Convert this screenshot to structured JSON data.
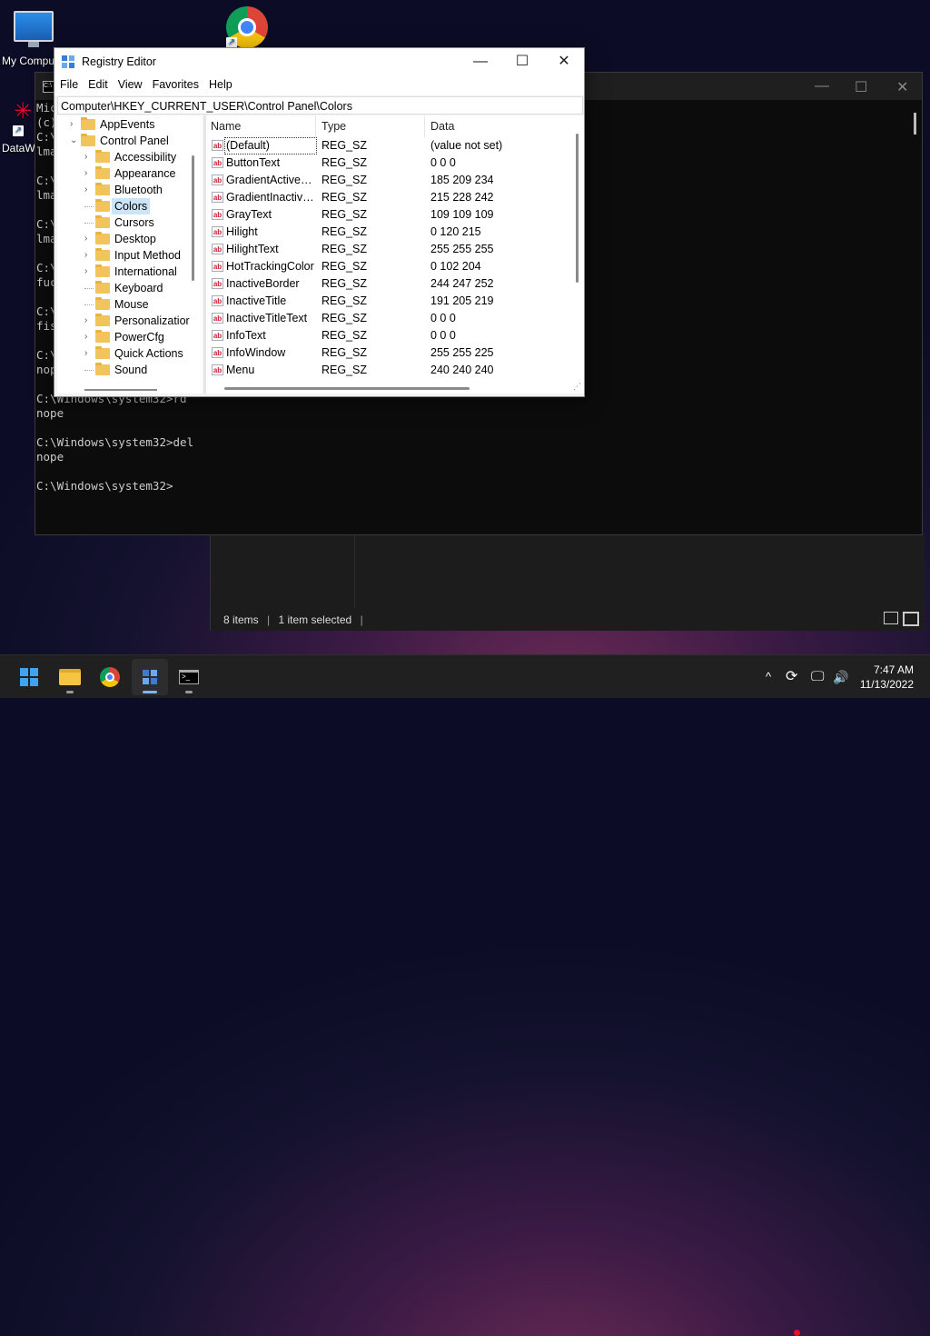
{
  "desktop": {
    "icons": [
      {
        "label": "My Compu"
      },
      {
        "label": "DataW"
      }
    ]
  },
  "cmd": {
    "lines": [
      "Mic",
      "(c)",
      "C:\\",
      "lma",
      "",
      "C:\\",
      "lma",
      "",
      "C:\\",
      "lma",
      "",
      "C:\\",
      "fuc",
      "",
      "C:\\",
      "fis",
      "",
      "C:\\",
      "nop",
      "",
      "C:\\Windows\\system32>rd",
      "nope",
      "",
      "C:\\Windows\\system32>del",
      "nope",
      "",
      "C:\\Windows\\system32>"
    ],
    "controls": {
      "minimize": "—",
      "maximize": "☐",
      "close": "✕"
    }
  },
  "explorer": {
    "status": {
      "items": "8 items",
      "selected": "1 item selected"
    }
  },
  "regedit": {
    "title": "Registry Editor",
    "controls": {
      "minimize": "—",
      "maximize": "☐",
      "close": "✕"
    },
    "menu": [
      "File",
      "Edit",
      "View",
      "Favorites",
      "Help"
    ],
    "address": "Computer\\HKEY_CURRENT_USER\\Control Panel\\Colors",
    "tree": [
      {
        "label": "AppEvents",
        "level": 0,
        "expander": "›"
      },
      {
        "label": "Control Panel",
        "level": 0,
        "expander": "⌄"
      },
      {
        "label": "Accessibility",
        "level": 1,
        "expander": "›"
      },
      {
        "label": "Appearance",
        "level": 1,
        "expander": "›"
      },
      {
        "label": "Bluetooth",
        "level": 1,
        "expander": "›"
      },
      {
        "label": "Colors",
        "level": 1,
        "expander": "",
        "selected": true
      },
      {
        "label": "Cursors",
        "level": 1,
        "expander": ""
      },
      {
        "label": "Desktop",
        "level": 1,
        "expander": "›"
      },
      {
        "label": "Input Method",
        "level": 1,
        "expander": "›"
      },
      {
        "label": "International",
        "level": 1,
        "expander": "›"
      },
      {
        "label": "Keyboard",
        "level": 1,
        "expander": ""
      },
      {
        "label": "Mouse",
        "level": 1,
        "expander": ""
      },
      {
        "label": "Personalizatior",
        "level": 1,
        "expander": "›"
      },
      {
        "label": "PowerCfg",
        "level": 1,
        "expander": "›"
      },
      {
        "label": "Quick Actions",
        "level": 1,
        "expander": "›"
      },
      {
        "label": "Sound",
        "level": 1,
        "expander": ""
      }
    ],
    "columns": {
      "name": "Name",
      "type": "Type",
      "data": "Data"
    },
    "values": [
      {
        "name": "(Default)",
        "type": "REG_SZ",
        "data": "(value not set)"
      },
      {
        "name": "ButtonText",
        "type": "REG_SZ",
        "data": "0 0 0"
      },
      {
        "name": "GradientActiveTi...",
        "type": "REG_SZ",
        "data": "185 209 234"
      },
      {
        "name": "GradientInactive...",
        "type": "REG_SZ",
        "data": "215 228 242"
      },
      {
        "name": "GrayText",
        "type": "REG_SZ",
        "data": "109 109 109"
      },
      {
        "name": "Hilight",
        "type": "REG_SZ",
        "data": "0 120 215"
      },
      {
        "name": "HilightText",
        "type": "REG_SZ",
        "data": "255 255 255"
      },
      {
        "name": "HotTrackingColor",
        "type": "REG_SZ",
        "data": "0 102 204"
      },
      {
        "name": "InactiveBorder",
        "type": "REG_SZ",
        "data": "244 247 252"
      },
      {
        "name": "InactiveTitle",
        "type": "REG_SZ",
        "data": "191 205 219"
      },
      {
        "name": "InactiveTitleText",
        "type": "REG_SZ",
        "data": "0 0 0"
      },
      {
        "name": "InfoText",
        "type": "REG_SZ",
        "data": "0 0 0"
      },
      {
        "name": "InfoWindow",
        "type": "REG_SZ",
        "data": "255 255 225"
      },
      {
        "name": "Menu",
        "type": "REG_SZ",
        "data": "240 240 240"
      }
    ],
    "value_icon": "ab"
  },
  "taskbar": {
    "clock": {
      "time": "7:47 AM",
      "date": "11/13/2022"
    },
    "tray": {
      "chevron": "^",
      "volume": "🔊"
    }
  },
  "colors": {
    "accent": "#3ea4f0",
    "selection": "#cce4f7",
    "folder": "#f2c55c"
  }
}
